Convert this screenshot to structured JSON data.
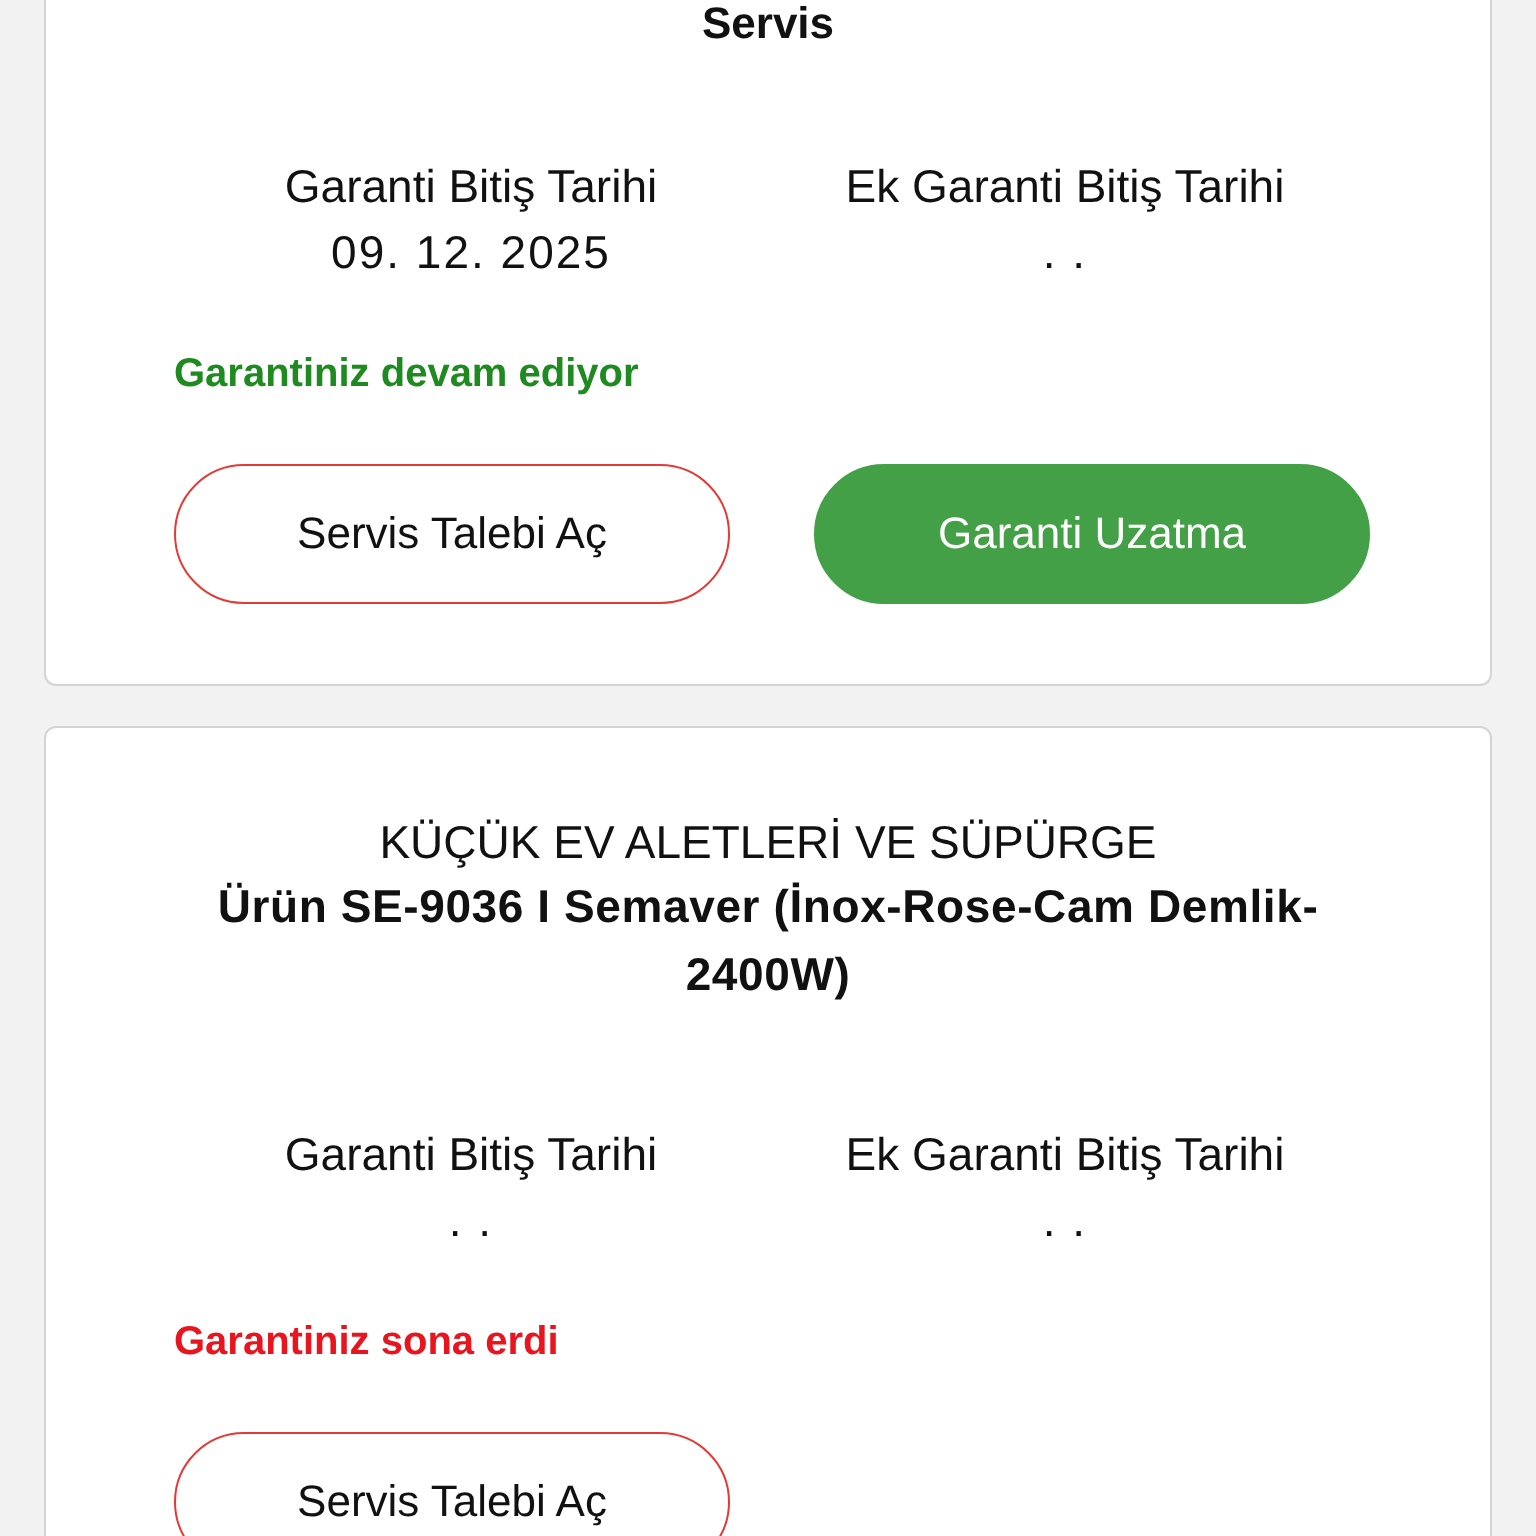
{
  "cards": [
    {
      "category": "Servis",
      "warranty_end": {
        "label": "Garanti Bitiş Tarihi",
        "value": "09. 12. 2025"
      },
      "extra_warranty_end": {
        "label": "Ek Garanti Bitiş Tarihi",
        "value": ". ."
      },
      "status": {
        "text": "Garantiniz devam ediyor",
        "active": true
      },
      "buttons": [
        {
          "label": "Servis Talebi Aç",
          "kind": "outline"
        },
        {
          "label": "Garanti Uzatma",
          "kind": "filled"
        }
      ]
    },
    {
      "category": "KÜÇÜK EV ALETLERİ VE SÜPÜRGE",
      "product": "Ürün SE-9036 I Semaver (İnox-Rose-Cam Demlik-2400W)",
      "warranty_end": {
        "label": "Garanti Bitiş Tarihi",
        "value": ". ."
      },
      "extra_warranty_end": {
        "label": "Ek Garanti Bitiş Tarihi",
        "value": ". ."
      },
      "status": {
        "text": "Garantiniz sona erdi",
        "active": false
      },
      "buttons": [
        {
          "label": "Servis Talebi Aç",
          "kind": "outline"
        }
      ]
    }
  ]
}
